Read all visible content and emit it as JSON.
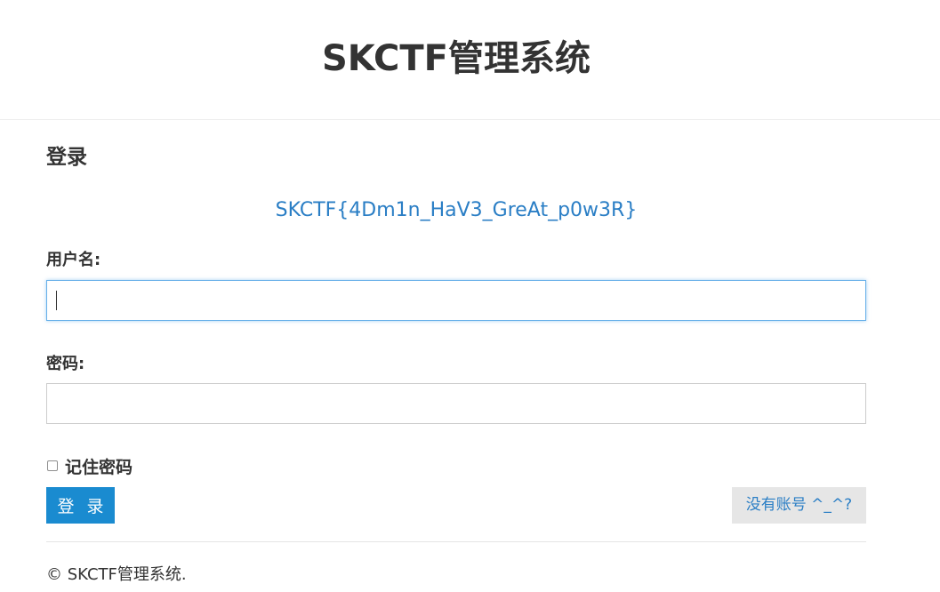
{
  "header": {
    "site_title": "SKCTF管理系统"
  },
  "login": {
    "section_title": "登录",
    "flag_text": "SKCTF{4Dm1n_HaV3_GreAt_p0w3R}",
    "username_label": "用户名:",
    "username_value": "",
    "password_label": "密码:",
    "password_value": "",
    "remember_label": "记住密码",
    "remember_checked": false,
    "login_button": "登 录",
    "register_link": "没有账号 ^_^?"
  },
  "footer": {
    "copyright": "© SKCTF管理系统."
  },
  "colors": {
    "primary_button": "#1a8bd0",
    "link": "#2a7ec5",
    "focus_border": "#66afe9"
  }
}
